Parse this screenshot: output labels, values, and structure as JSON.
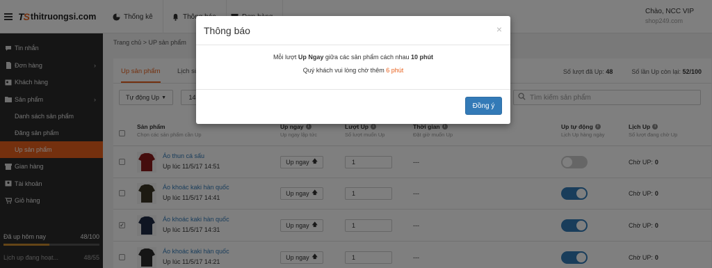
{
  "brand": {
    "mark": "TS",
    "name": "thitruongsi.com"
  },
  "topbar": {
    "items": [
      {
        "label": "Thống kê",
        "icon": "pie-chart-icon"
      },
      {
        "label": "Thông báo",
        "icon": "bell-icon"
      },
      {
        "label": "Đơn hàng",
        "icon": "box-icon"
      }
    ],
    "user_greeting": "Chào, NCC VIP",
    "user_shop": "shop249.com"
  },
  "sidebar": {
    "items": [
      {
        "label": "Tin nhắn",
        "icon": "chat-icon"
      },
      {
        "label": "Đơn hàng",
        "icon": "document-icon",
        "has_children": true
      },
      {
        "label": "Khách hàng",
        "icon": "id-card-icon"
      },
      {
        "label": "Sản phẩm",
        "icon": "folder-icon",
        "has_children": true
      }
    ],
    "sub_items": [
      {
        "label": "Danh sách sản phẩm",
        "active": false
      },
      {
        "label": "Đăng sản phẩm",
        "active": false
      },
      {
        "label": "Up sản phẩm",
        "active": true
      }
    ],
    "items_after": [
      {
        "label": "Gian hàng",
        "icon": "store-icon"
      },
      {
        "label": "Tài khoản",
        "icon": "user-icon"
      },
      {
        "label": "Giỏ hàng",
        "icon": "cart-icon"
      }
    ],
    "quota_label": "Đã up hôm nay",
    "quota_value": "48/100",
    "quota_fraction": 0.48,
    "quota_next_label": "Lịch up đang hoạt...",
    "quota_next_value": "48/55"
  },
  "breadcrumb": "Trang chủ > UP sản phẩm",
  "tabs": [
    {
      "label": "Up sản phẩm",
      "active": true
    },
    {
      "label": "Lịch sử",
      "active": false
    }
  ],
  "stats": {
    "used_label": "Số lượt đã Up:",
    "used_value": "48",
    "left_label": "Số lần Up còn lại:",
    "left_value": "52/100"
  },
  "toolbar": {
    "auto_up_label": "Tự động Up",
    "date_filter_value": "14"
  },
  "search": {
    "placeholder": "Tìm kiếm sản phẩm"
  },
  "table": {
    "columns": [
      {
        "title": "Sản phẩm",
        "sub": "Chọn các sản phẩm cần Up",
        "info": false
      },
      {
        "title": "Up ngay",
        "sub": "Up ngay lập tức",
        "info": true
      },
      {
        "title": "Lượt Up",
        "sub": "Số lượt muốn Up",
        "info": true
      },
      {
        "title": "Thời gian",
        "sub": "Đặt giờ muốn Up",
        "info": true
      },
      {
        "title": "Up tự động",
        "sub": "Lịch Up hàng ngày",
        "info": true
      },
      {
        "title": "Lịch Up",
        "sub": "Số lượt đang chờ Up",
        "info": true
      }
    ],
    "up_button_label": "Up ngay",
    "rows": [
      {
        "name": "Áo thun cá sấu",
        "up_time": "Up lúc 11/5/17 14:51",
        "qty": "1",
        "time": "---",
        "auto_up": false,
        "waiting_label": "Chờ UP:",
        "waiting": "0",
        "checked": false,
        "thumb_color": "#8b1a1a"
      },
      {
        "name": "Áo khoác kaki hàn quốc",
        "up_time": "Up lúc 11/5/17 14:41",
        "qty": "1",
        "time": "---",
        "auto_up": true,
        "waiting_label": "Chờ UP:",
        "waiting": "0",
        "checked": false,
        "thumb_color": "#3b3525"
      },
      {
        "name": "Áo khoác kaki hàn quốc",
        "up_time": "Up lúc 11/5/17 14:31",
        "qty": "1",
        "time": "---",
        "auto_up": true,
        "waiting_label": "Chờ UP:",
        "waiting": "0",
        "checked": true,
        "thumb_color": "#1e2a44"
      },
      {
        "name": "Áo khoác kaki hàn quốc",
        "up_time": "Up lúc 11/5/17 14:21",
        "qty": "1",
        "time": "---",
        "auto_up": true,
        "waiting_label": "Chờ UP:",
        "waiting": "0",
        "checked": false,
        "thumb_color": "#2a2a2a"
      }
    ]
  },
  "modal": {
    "title": "Thông báo",
    "close_glyph": "×",
    "line1_prefix": "Mỗi lượt",
    "line1_bold1": "Up Ngay",
    "line1_mid": "giữa các sản phẩm cách nhau",
    "line1_bold2": "10 phút",
    "line2_prefix": "Quý khách vui lòng chờ thêm",
    "line2_highlight": "6 phút",
    "ok_label": "Đồng ý"
  },
  "colors": {
    "accent": "#e8601c",
    "primary": "#337ab7",
    "toggle_on": "#337ab7",
    "toggle_off": "#cccccc",
    "sidebar_bg": "#2b2b2b"
  }
}
